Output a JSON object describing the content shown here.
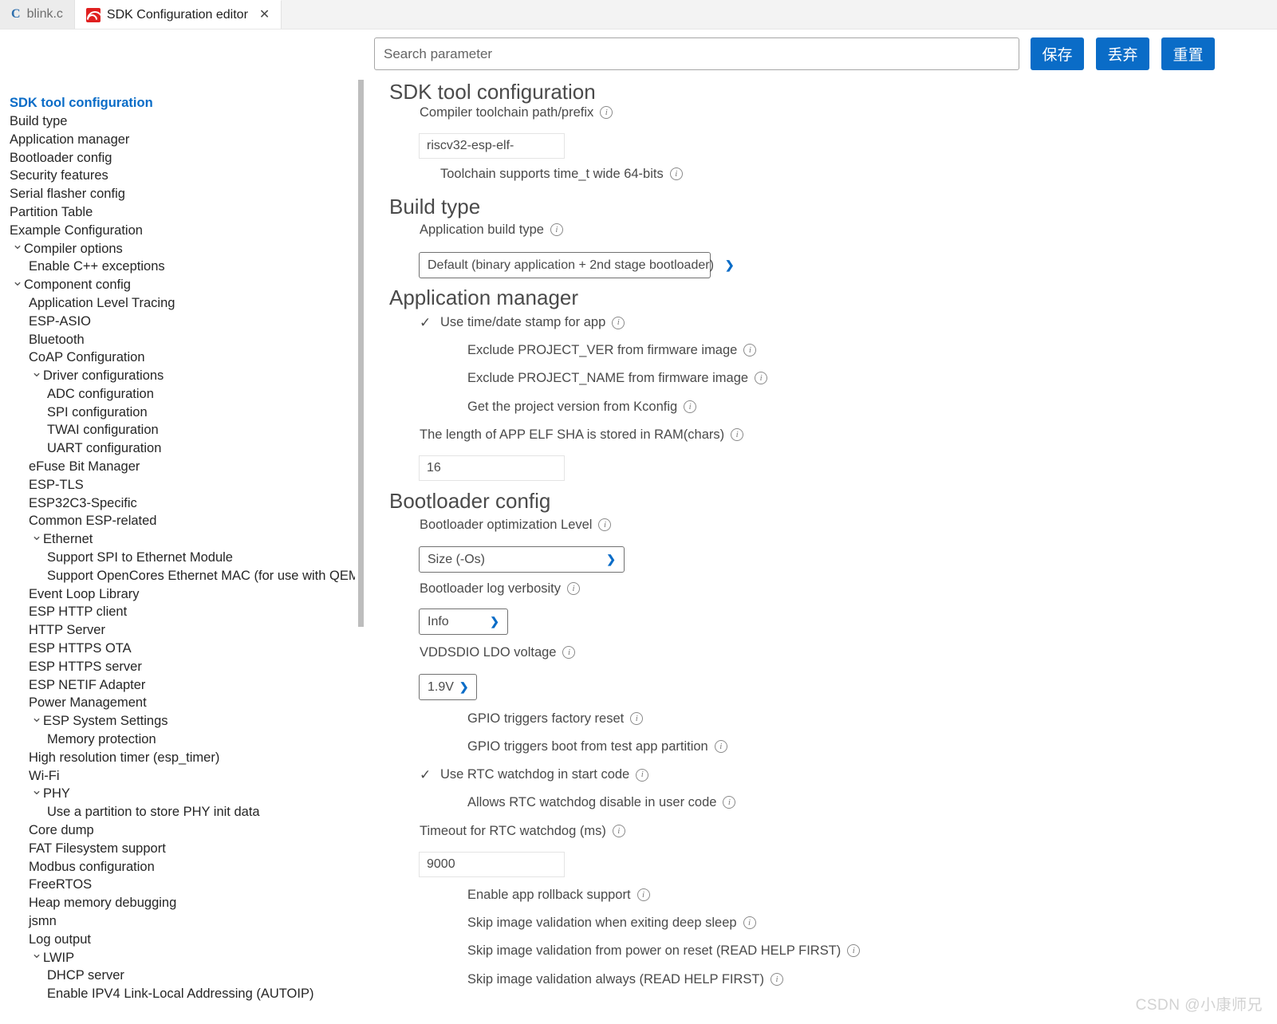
{
  "tabs": [
    {
      "label": "blink.c",
      "icon": "c-file-icon",
      "active": false,
      "closable": false
    },
    {
      "label": "SDK Configuration editor",
      "icon": "espressif-logo-icon",
      "active": true,
      "closable": true
    }
  ],
  "toolbar": {
    "search_placeholder": "Search parameter",
    "search_value": "",
    "save_label": "保存",
    "discard_label": "丢弃",
    "reset_label": "重置",
    "accent_color": "#0a6cc7"
  },
  "sidebar": {
    "items": [
      {
        "label": "SDK tool configuration",
        "level": 0,
        "chevron": "",
        "selected": true
      },
      {
        "label": "Build type",
        "level": 0,
        "chevron": "",
        "selected": false
      },
      {
        "label": "Application manager",
        "level": 0,
        "chevron": "",
        "selected": false
      },
      {
        "label": "Bootloader config",
        "level": 0,
        "chevron": "",
        "selected": false
      },
      {
        "label": "Security features",
        "level": 0,
        "chevron": "",
        "selected": false
      },
      {
        "label": "Serial flasher config",
        "level": 0,
        "chevron": "",
        "selected": false
      },
      {
        "label": "Partition Table",
        "level": 0,
        "chevron": "",
        "selected": false
      },
      {
        "label": "Example Configuration",
        "level": 0,
        "chevron": "",
        "selected": false
      },
      {
        "label": "Compiler options",
        "level": 0,
        "chevron": "v",
        "selected": false
      },
      {
        "label": "Enable C++ exceptions",
        "level": 1,
        "chevron": "",
        "selected": false
      },
      {
        "label": "Component config",
        "level": 0,
        "chevron": "v",
        "selected": false
      },
      {
        "label": "Application Level Tracing",
        "level": 1,
        "chevron": "",
        "selected": false
      },
      {
        "label": "ESP-ASIO",
        "level": 1,
        "chevron": "",
        "selected": false
      },
      {
        "label": "Bluetooth",
        "level": 1,
        "chevron": "",
        "selected": false
      },
      {
        "label": "CoAP Configuration",
        "level": 1,
        "chevron": "",
        "selected": false
      },
      {
        "label": "Driver configurations",
        "level": 1,
        "chevron": "v",
        "selected": false
      },
      {
        "label": "ADC configuration",
        "level": 2,
        "chevron": "",
        "selected": false
      },
      {
        "label": "SPI configuration",
        "level": 2,
        "chevron": "",
        "selected": false
      },
      {
        "label": "TWAI configuration",
        "level": 2,
        "chevron": "",
        "selected": false
      },
      {
        "label": "UART configuration",
        "level": 2,
        "chevron": "",
        "selected": false
      },
      {
        "label": "eFuse Bit Manager",
        "level": 1,
        "chevron": "",
        "selected": false
      },
      {
        "label": "ESP-TLS",
        "level": 1,
        "chevron": "",
        "selected": false
      },
      {
        "label": "ESP32C3-Specific",
        "level": 1,
        "chevron": "",
        "selected": false
      },
      {
        "label": "Common ESP-related",
        "level": 1,
        "chevron": "",
        "selected": false
      },
      {
        "label": "Ethernet",
        "level": 1,
        "chevron": "v",
        "selected": false
      },
      {
        "label": "Support SPI to Ethernet Module",
        "level": 2,
        "chevron": "",
        "selected": false
      },
      {
        "label": "Support OpenCores Ethernet MAC (for use with QEMU)",
        "level": 2,
        "chevron": "",
        "selected": false
      },
      {
        "label": "Event Loop Library",
        "level": 1,
        "chevron": "",
        "selected": false
      },
      {
        "label": "ESP HTTP client",
        "level": 1,
        "chevron": "",
        "selected": false
      },
      {
        "label": "HTTP Server",
        "level": 1,
        "chevron": "",
        "selected": false
      },
      {
        "label": "ESP HTTPS OTA",
        "level": 1,
        "chevron": "",
        "selected": false
      },
      {
        "label": "ESP HTTPS server",
        "level": 1,
        "chevron": "",
        "selected": false
      },
      {
        "label": "ESP NETIF Adapter",
        "level": 1,
        "chevron": "",
        "selected": false
      },
      {
        "label": "Power Management",
        "level": 1,
        "chevron": "",
        "selected": false
      },
      {
        "label": "ESP System Settings",
        "level": 1,
        "chevron": "v",
        "selected": false
      },
      {
        "label": "Memory protection",
        "level": 2,
        "chevron": "",
        "selected": false
      },
      {
        "label": "High resolution timer (esp_timer)",
        "level": 1,
        "chevron": "",
        "selected": false
      },
      {
        "label": "Wi-Fi",
        "level": 1,
        "chevron": "",
        "selected": false
      },
      {
        "label": "PHY",
        "level": 1,
        "chevron": "v",
        "selected": false
      },
      {
        "label": "Use a partition to store PHY init data",
        "level": 2,
        "chevron": "",
        "selected": false
      },
      {
        "label": "Core dump",
        "level": 1,
        "chevron": "",
        "selected": false
      },
      {
        "label": "FAT Filesystem support",
        "level": 1,
        "chevron": "",
        "selected": false
      },
      {
        "label": "Modbus configuration",
        "level": 1,
        "chevron": "",
        "selected": false
      },
      {
        "label": "FreeRTOS",
        "level": 1,
        "chevron": "",
        "selected": false
      },
      {
        "label": "Heap memory debugging",
        "level": 1,
        "chevron": "",
        "selected": false
      },
      {
        "label": "jsmn",
        "level": 1,
        "chevron": "",
        "selected": false
      },
      {
        "label": "Log output",
        "level": 1,
        "chevron": "",
        "selected": false
      },
      {
        "label": "LWIP",
        "level": 1,
        "chevron": "v",
        "selected": false
      },
      {
        "label": "DHCP server",
        "level": 2,
        "chevron": "",
        "selected": false
      },
      {
        "label": "Enable IPV4 Link-Local Addressing (AUTOIP)",
        "level": 2,
        "chevron": "",
        "selected": false
      }
    ]
  },
  "main": {
    "sections": [
      {
        "title": "SDK tool configuration",
        "fields": {
          "toolchain_prefix_label": "Compiler toolchain path/prefix",
          "toolchain_prefix_value": "riscv32-esp-elf-",
          "time_t_label": "Toolchain supports time_t wide 64-bits",
          "time_t_checked": false
        }
      },
      {
        "title": "Build type",
        "fields": {
          "app_build_type_label": "Application build type",
          "app_build_type_value": "Default (binary application + 2nd stage bootloader)"
        }
      },
      {
        "title": "Application manager",
        "fields": {
          "timestamp_label": "Use time/date stamp for app",
          "timestamp_checked": true,
          "exclude_ver_label": "Exclude PROJECT_VER from firmware image",
          "exclude_ver_checked": false,
          "exclude_name_label": "Exclude PROJECT_NAME from firmware image",
          "exclude_name_checked": false,
          "kconfig_ver_label": "Get the project version from Kconfig",
          "kconfig_ver_checked": false,
          "elf_sha_label": "The length of APP ELF SHA is stored in RAM(chars)",
          "elf_sha_value": "16"
        }
      },
      {
        "title": "Bootloader config",
        "fields": {
          "opt_level_label": "Bootloader optimization Level",
          "opt_level_value": "Size (-Os)",
          "log_verbosity_label": "Bootloader log verbosity",
          "log_verbosity_value": "Info",
          "vddsdio_label": "VDDSDIO LDO voltage",
          "vddsdio_value": "1.9V",
          "gpio_factory_reset_label": "GPIO triggers factory reset",
          "gpio_factory_reset_checked": false,
          "gpio_test_app_label": "GPIO triggers boot from test app partition",
          "gpio_test_app_checked": false,
          "rtc_wdt_label": "Use RTC watchdog in start code",
          "rtc_wdt_checked": true,
          "rtc_wdt_disable_label": "Allows RTC watchdog disable in user code",
          "rtc_wdt_disable_checked": false,
          "rtc_wdt_timeout_label": "Timeout for RTC watchdog (ms)",
          "rtc_wdt_timeout_value": "9000",
          "rollback_label": "Enable app rollback support",
          "rollback_checked": false,
          "skip_deep_sleep_label": "Skip image validation when exiting deep sleep",
          "skip_deep_sleep_checked": false,
          "skip_power_on_label": "Skip image validation from power on reset (READ HELP FIRST)",
          "skip_power_on_checked": false,
          "skip_always_label": "Skip image validation always (READ HELP FIRST)",
          "skip_always_checked": false
        }
      }
    ],
    "checkmark_glyph": "✓",
    "info_glyph": "i"
  },
  "watermark": {
    "text": "CSDN @小康师兄"
  }
}
